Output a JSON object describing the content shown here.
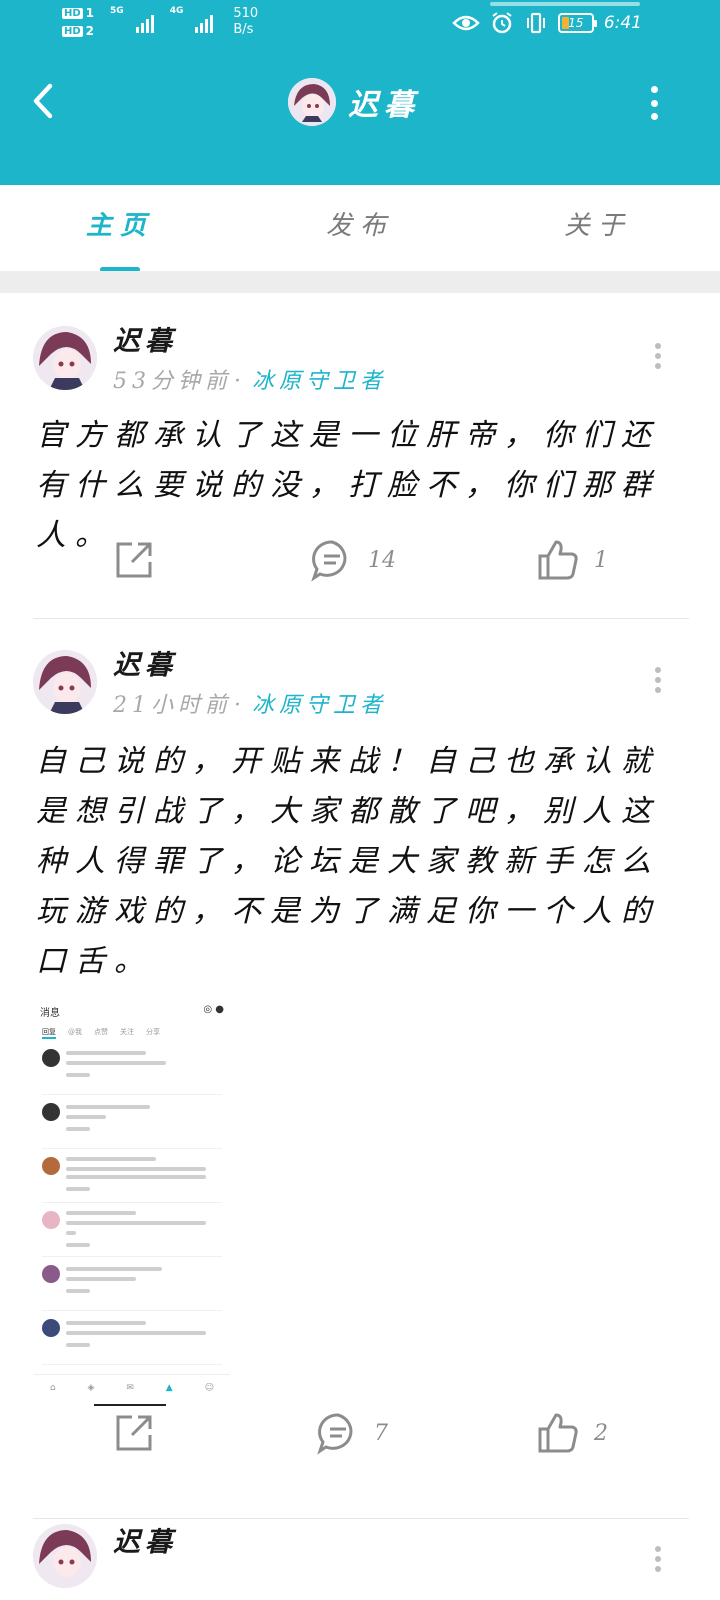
{
  "status_bar": {
    "hd1": "HD",
    "hd1_num": "1",
    "hd2": "HD",
    "hd2_num": "2",
    "net1": "5G",
    "net2": "4G",
    "speed_value": "510",
    "speed_unit": "B/s",
    "battery": "15",
    "time": "6:41"
  },
  "header": {
    "title": "迟暮"
  },
  "tabs": [
    {
      "label": "主页",
      "active": true
    },
    {
      "label": "发布",
      "active": false
    },
    {
      "label": "关于",
      "active": false
    }
  ],
  "posts": [
    {
      "author": "迟暮",
      "time": "53分钟前",
      "board": "冰原守卫者",
      "content": "官方都承认了这是一位肝帝，你们还有什么要说的没，打脸不，你们那群人。",
      "comments": "14",
      "likes": "1"
    },
    {
      "author": "迟暮",
      "time": "21小时前",
      "board": "冰原守卫者",
      "content": "自己说的，开贴来战！自己也承认就是想引战了，大家都散了吧，别人这种人得罪了，论坛是大家教新手怎么玩游戏的，不是为了满足你一个人的口舌。",
      "comments": "7",
      "likes": "2"
    },
    {
      "author": "迟暮"
    }
  ],
  "embedded_screenshot": {
    "title": "消息",
    "tabs": [
      "回复",
      "@我",
      "点赞",
      "关注",
      "分享"
    ]
  },
  "icons": {
    "back": "back-arrow-icon",
    "more": "more-vertical-icon",
    "share": "share-icon",
    "comment": "comment-icon",
    "like": "thumbs-up-icon"
  },
  "colors": {
    "accent": "#1cb5c9",
    "muted": "#a8a8a8"
  }
}
